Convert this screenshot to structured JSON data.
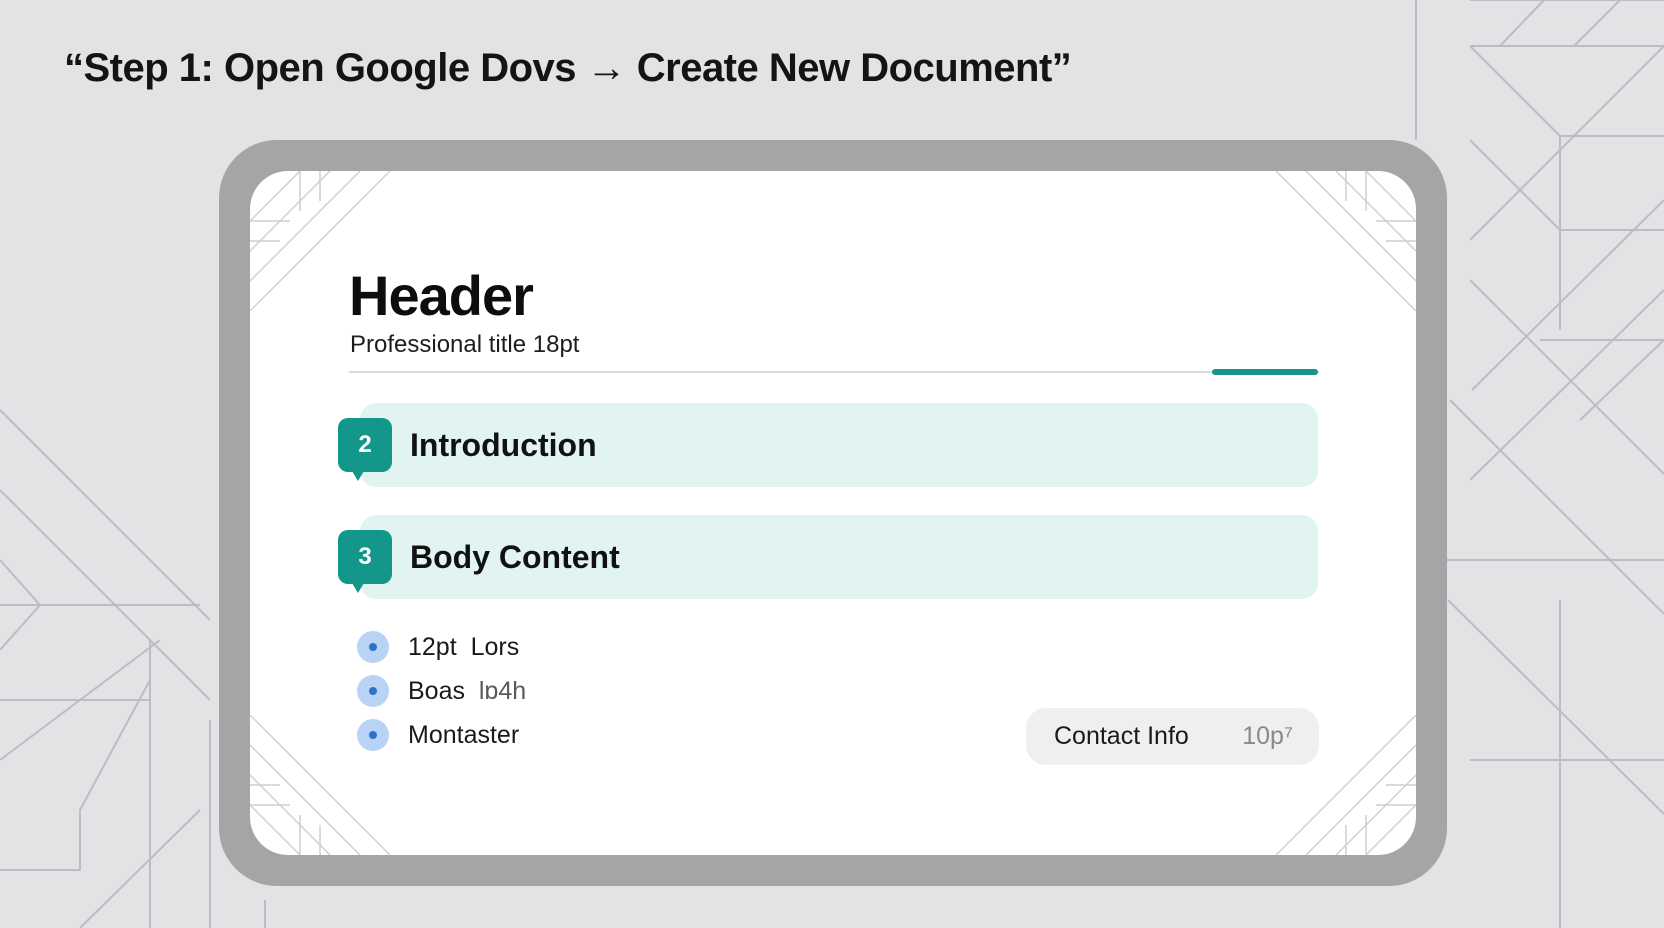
{
  "page_title": "“Step 1: Open Google Dovs → Create New Document”",
  "document": {
    "header": "Header",
    "subtitle": "Professional title 18pt",
    "sections": [
      {
        "number": "2",
        "label": "Introduction"
      },
      {
        "number": "3",
        "label": "Body Content"
      }
    ],
    "bullets": [
      {
        "primary": "12pt",
        "secondary": "Lors"
      },
      {
        "primary": "Boas",
        "secondary": "lɒ4h"
      },
      {
        "primary": "Montaster",
        "secondary": ""
      }
    ],
    "contact": {
      "label": "Contact Info",
      "size": "10p⁷"
    }
  },
  "colors": {
    "accent_teal": "#14978b",
    "section_fill": "#e1f4f2",
    "bullet_dot": "#b9d3f7",
    "device_frame": "#a5a5a8"
  }
}
